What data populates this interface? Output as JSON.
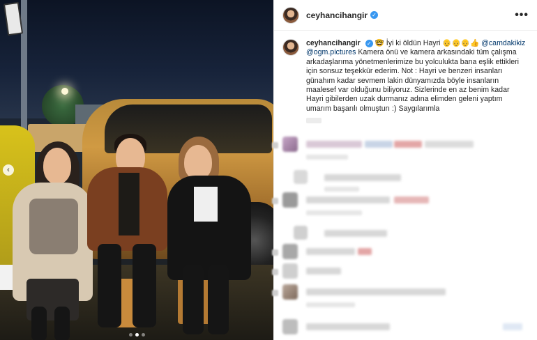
{
  "post": {
    "username": "ceyhancihangir",
    "verified_icon": "verified-badge-icon",
    "more_icon": "more-options-icon",
    "more_label": "•••"
  },
  "caption": {
    "username": "ceyhancihangir",
    "line_intro": "🤓 İyi ki öldün Hayri 👴👴👴👍 ",
    "mention_1": "@camdakikiz",
    "mention_2": "@ogm.pictures",
    "body": " Kamera önü ve kamera arkasındaki tüm çalışma arkadaşlarıma yönetmenlerimize bu yolculukta bana eşlik ettikleri için sonsuz teşekkür ederim. Not : Hayri ve benzeri insanları günahım kadar sevmem lakin dünyamızda böyle insanların maalesef var olduğunu biliyoruz. Sizlerinde en az benim kadar Hayri gibilerden uzak durmanız adına elimden geleni yaptım umarım başarılı olmuşturı :) Saygılarımla"
  },
  "carousel": {
    "prev_label": "‹",
    "dot_count": 3,
    "active_dot": 1
  },
  "colors": {
    "verified": "#3897f0",
    "mention": "#00376b",
    "text": "#262626",
    "border": "#efefef"
  }
}
